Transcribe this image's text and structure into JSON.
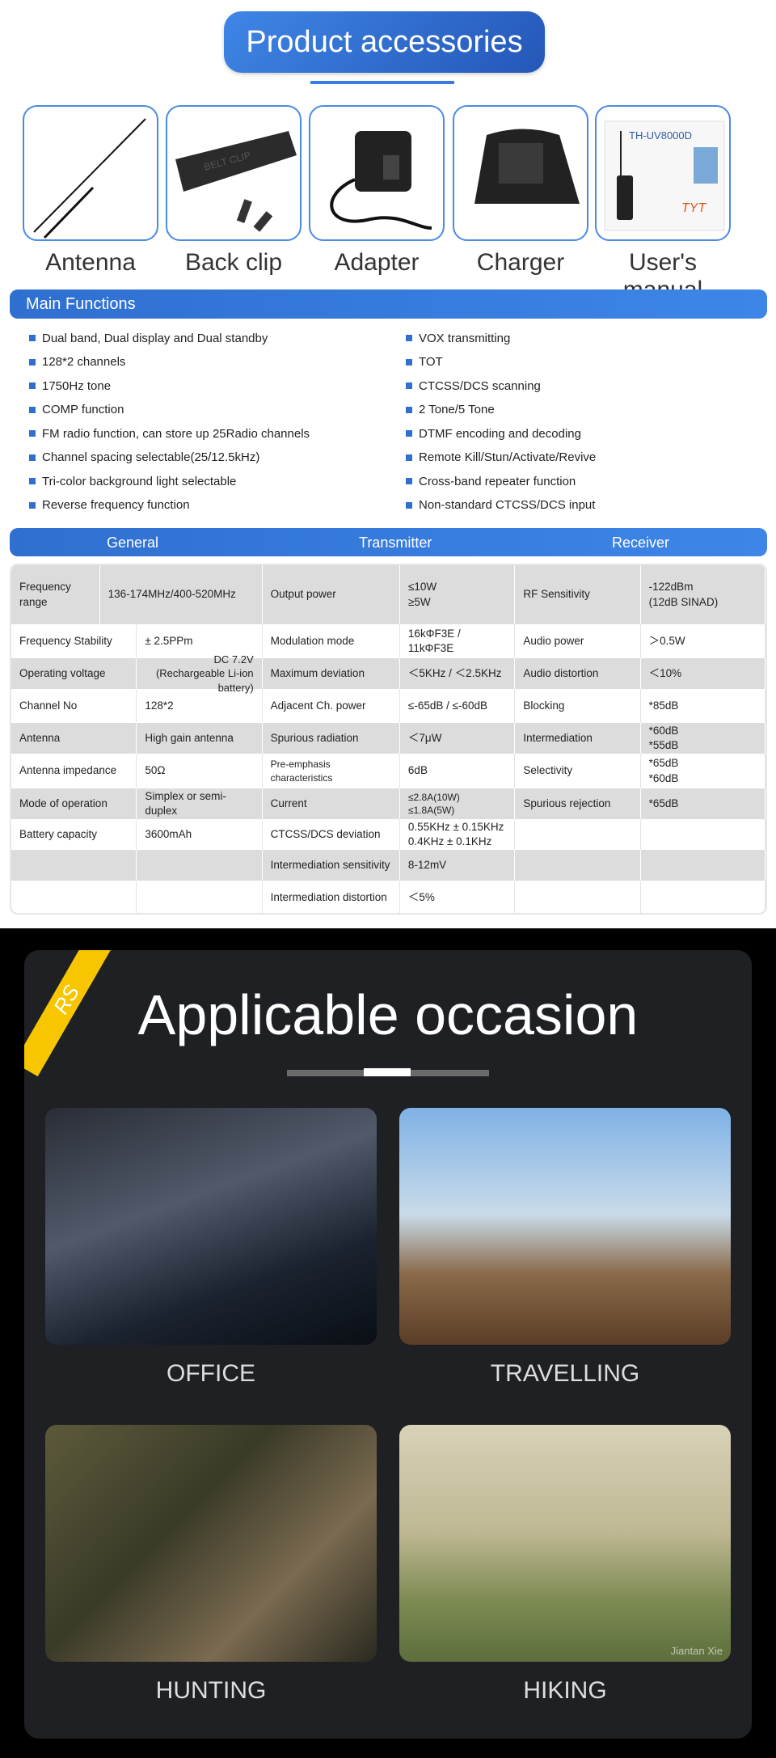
{
  "header": {
    "title": "Product accessories"
  },
  "accessories": [
    {
      "label": "Antenna",
      "icon": "antenna-image"
    },
    {
      "label": "Back clip",
      "icon": "back-clip-image",
      "imprint": "BELT CLIP"
    },
    {
      "label": "Adapter",
      "icon": "adapter-image"
    },
    {
      "label": "Charger",
      "icon": "charger-image"
    },
    {
      "label": "User's manual",
      "icon": "manual-image",
      "imprint": "TH-UV8000D"
    }
  ],
  "main_functions": {
    "title": "Main Functions",
    "left": [
      "Dual band, Dual display and Dual standby",
      "128*2 channels",
      "1750Hz tone",
      "COMP function",
      "FM radio function, can store up 25Radio channels",
      "Channel spacing selectable(25/12.5kHz)",
      "Tri-color background light selectable",
      "Reverse frequency function"
    ],
    "right": [
      "VOX transmitting",
      "TOT",
      "CTCSS/DCS scanning",
      "2 Tone/5 Tone",
      "DTMF encoding and decoding",
      "Remote Kill/Stun/Activate/Revive",
      "Cross-band repeater function",
      "Non-standard CTCSS/DCS input"
    ]
  },
  "spec_headers": [
    "General",
    "Transmitter",
    "Receiver"
  ],
  "spec_rows": [
    [
      "Frequency range",
      "136-174MHz/400-520MHz",
      "Output power",
      "≤10W\n≥5W",
      "RF Sensitivity",
      "-122dBm\n(12dB SINAD)"
    ],
    [
      "Frequency Stability",
      "± 2.5PPm",
      "Modulation mode",
      "16kΦF3E / 11kΦF3E",
      "Audio power",
      "＞0.5W"
    ],
    [
      "Operating voltage",
      "DC 7.2V (Rechargeable Li-ion battery)",
      "Maximum deviation",
      "＜5KHz / ＜2.5KHz",
      "Audio distortion",
      "＜10%"
    ],
    [
      "Channel No",
      "128*2",
      "Adjacent Ch. power",
      "≤-65dB / ≤-60dB",
      "Blocking",
      "*85dB"
    ],
    [
      "Antenna",
      "High gain antenna",
      "Spurious radiation",
      "＜7μW",
      "Intermediation",
      "*60dB\n*55dB"
    ],
    [
      "Antenna impedance",
      "50Ω",
      "Pre-emphasis characteristics",
      "6dB",
      "Selectivity",
      "*65dB\n*60dB"
    ],
    [
      "Mode of operation",
      "Simplex or semi-duplex",
      "Current",
      "≤2.8A(10W) ≤1.8A(5W)",
      "Spurious rejection",
      "*65dB"
    ],
    [
      "Battery capacity",
      "3600mAh",
      "CTCSS/DCS deviation",
      "0.55KHz ± 0.15KHz\n0.4KHz ± 0.1KHz",
      "",
      ""
    ],
    [
      "",
      "",
      "Intermediation sensitivity",
      "8-12mV",
      "",
      ""
    ],
    [
      "",
      "",
      "Intermediation distortion",
      "＜5%",
      "",
      ""
    ]
  ],
  "occasion": {
    "badge": "RS",
    "title": "Applicable occasion",
    "items": [
      {
        "label": "OFFICE"
      },
      {
        "label": "TRAVELLING"
      },
      {
        "label": "HUNTING"
      },
      {
        "label": "HIKING"
      }
    ],
    "watermark": "Jiantan Xie"
  },
  "colors": {
    "accent": "#3a7be0",
    "badge": "#f7c600",
    "card": "#1e2024"
  }
}
